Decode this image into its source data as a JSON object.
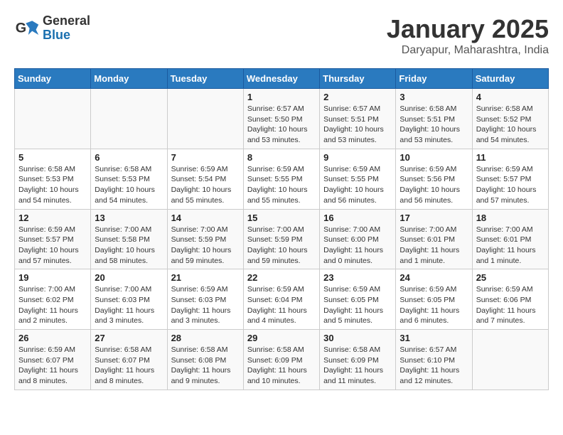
{
  "header": {
    "logo_general": "General",
    "logo_blue": "Blue",
    "month_title": "January 2025",
    "location": "Daryapur, Maharashtra, India"
  },
  "weekdays": [
    "Sunday",
    "Monday",
    "Tuesday",
    "Wednesday",
    "Thursday",
    "Friday",
    "Saturday"
  ],
  "weeks": [
    [
      {
        "day": "",
        "info": ""
      },
      {
        "day": "",
        "info": ""
      },
      {
        "day": "",
        "info": ""
      },
      {
        "day": "1",
        "info": "Sunrise: 6:57 AM\nSunset: 5:50 PM\nDaylight: 10 hours\nand 53 minutes."
      },
      {
        "day": "2",
        "info": "Sunrise: 6:57 AM\nSunset: 5:51 PM\nDaylight: 10 hours\nand 53 minutes."
      },
      {
        "day": "3",
        "info": "Sunrise: 6:58 AM\nSunset: 5:51 PM\nDaylight: 10 hours\nand 53 minutes."
      },
      {
        "day": "4",
        "info": "Sunrise: 6:58 AM\nSunset: 5:52 PM\nDaylight: 10 hours\nand 54 minutes."
      }
    ],
    [
      {
        "day": "5",
        "info": "Sunrise: 6:58 AM\nSunset: 5:53 PM\nDaylight: 10 hours\nand 54 minutes."
      },
      {
        "day": "6",
        "info": "Sunrise: 6:58 AM\nSunset: 5:53 PM\nDaylight: 10 hours\nand 54 minutes."
      },
      {
        "day": "7",
        "info": "Sunrise: 6:59 AM\nSunset: 5:54 PM\nDaylight: 10 hours\nand 55 minutes."
      },
      {
        "day": "8",
        "info": "Sunrise: 6:59 AM\nSunset: 5:55 PM\nDaylight: 10 hours\nand 55 minutes."
      },
      {
        "day": "9",
        "info": "Sunrise: 6:59 AM\nSunset: 5:55 PM\nDaylight: 10 hours\nand 56 minutes."
      },
      {
        "day": "10",
        "info": "Sunrise: 6:59 AM\nSunset: 5:56 PM\nDaylight: 10 hours\nand 56 minutes."
      },
      {
        "day": "11",
        "info": "Sunrise: 6:59 AM\nSunset: 5:57 PM\nDaylight: 10 hours\nand 57 minutes."
      }
    ],
    [
      {
        "day": "12",
        "info": "Sunrise: 6:59 AM\nSunset: 5:57 PM\nDaylight: 10 hours\nand 57 minutes."
      },
      {
        "day": "13",
        "info": "Sunrise: 7:00 AM\nSunset: 5:58 PM\nDaylight: 10 hours\nand 58 minutes."
      },
      {
        "day": "14",
        "info": "Sunrise: 7:00 AM\nSunset: 5:59 PM\nDaylight: 10 hours\nand 59 minutes."
      },
      {
        "day": "15",
        "info": "Sunrise: 7:00 AM\nSunset: 5:59 PM\nDaylight: 10 hours\nand 59 minutes."
      },
      {
        "day": "16",
        "info": "Sunrise: 7:00 AM\nSunset: 6:00 PM\nDaylight: 11 hours\nand 0 minutes."
      },
      {
        "day": "17",
        "info": "Sunrise: 7:00 AM\nSunset: 6:01 PM\nDaylight: 11 hours\nand 1 minute."
      },
      {
        "day": "18",
        "info": "Sunrise: 7:00 AM\nSunset: 6:01 PM\nDaylight: 11 hours\nand 1 minute."
      }
    ],
    [
      {
        "day": "19",
        "info": "Sunrise: 7:00 AM\nSunset: 6:02 PM\nDaylight: 11 hours\nand 2 minutes."
      },
      {
        "day": "20",
        "info": "Sunrise: 7:00 AM\nSunset: 6:03 PM\nDaylight: 11 hours\nand 3 minutes."
      },
      {
        "day": "21",
        "info": "Sunrise: 6:59 AM\nSunset: 6:03 PM\nDaylight: 11 hours\nand 3 minutes."
      },
      {
        "day": "22",
        "info": "Sunrise: 6:59 AM\nSunset: 6:04 PM\nDaylight: 11 hours\nand 4 minutes."
      },
      {
        "day": "23",
        "info": "Sunrise: 6:59 AM\nSunset: 6:05 PM\nDaylight: 11 hours\nand 5 minutes."
      },
      {
        "day": "24",
        "info": "Sunrise: 6:59 AM\nSunset: 6:05 PM\nDaylight: 11 hours\nand 6 minutes."
      },
      {
        "day": "25",
        "info": "Sunrise: 6:59 AM\nSunset: 6:06 PM\nDaylight: 11 hours\nand 7 minutes."
      }
    ],
    [
      {
        "day": "26",
        "info": "Sunrise: 6:59 AM\nSunset: 6:07 PM\nDaylight: 11 hours\nand 8 minutes."
      },
      {
        "day": "27",
        "info": "Sunrise: 6:58 AM\nSunset: 6:07 PM\nDaylight: 11 hours\nand 8 minutes."
      },
      {
        "day": "28",
        "info": "Sunrise: 6:58 AM\nSunset: 6:08 PM\nDaylight: 11 hours\nand 9 minutes."
      },
      {
        "day": "29",
        "info": "Sunrise: 6:58 AM\nSunset: 6:09 PM\nDaylight: 11 hours\nand 10 minutes."
      },
      {
        "day": "30",
        "info": "Sunrise: 6:58 AM\nSunset: 6:09 PM\nDaylight: 11 hours\nand 11 minutes."
      },
      {
        "day": "31",
        "info": "Sunrise: 6:57 AM\nSunset: 6:10 PM\nDaylight: 11 hours\nand 12 minutes."
      },
      {
        "day": "",
        "info": ""
      }
    ]
  ]
}
